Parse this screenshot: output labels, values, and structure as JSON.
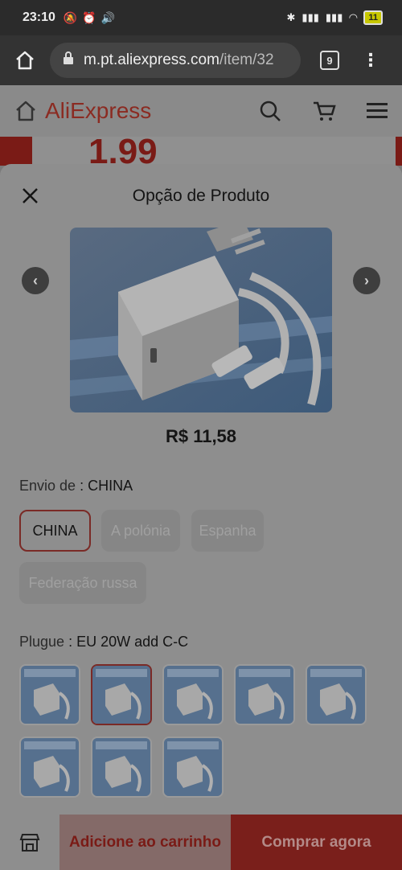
{
  "status": {
    "time": "23:10",
    "battery": "11"
  },
  "browser": {
    "url_host": "m.pt.aliexpress.com",
    "url_path": "/item/32",
    "tab_count": "9"
  },
  "page": {
    "logo": "AliExpress",
    "banner_price": "1.99"
  },
  "sheet": {
    "title": "Opção de Produto",
    "price": "R$ 11,58",
    "ship_label": "Envio de",
    "ship_value": ": CHINA",
    "ship_options": [
      "CHINA",
      "A polónia",
      "Espanha",
      "Federação russa"
    ],
    "plug_label": "Plugue",
    "plug_value": ": EU 20W add C-C",
    "plug_thumb_count": 8,
    "plug_selected_index": 1
  },
  "bottom": {
    "add_cart": "Adicione ao carrinho",
    "buy_now": "Comprar agora"
  }
}
